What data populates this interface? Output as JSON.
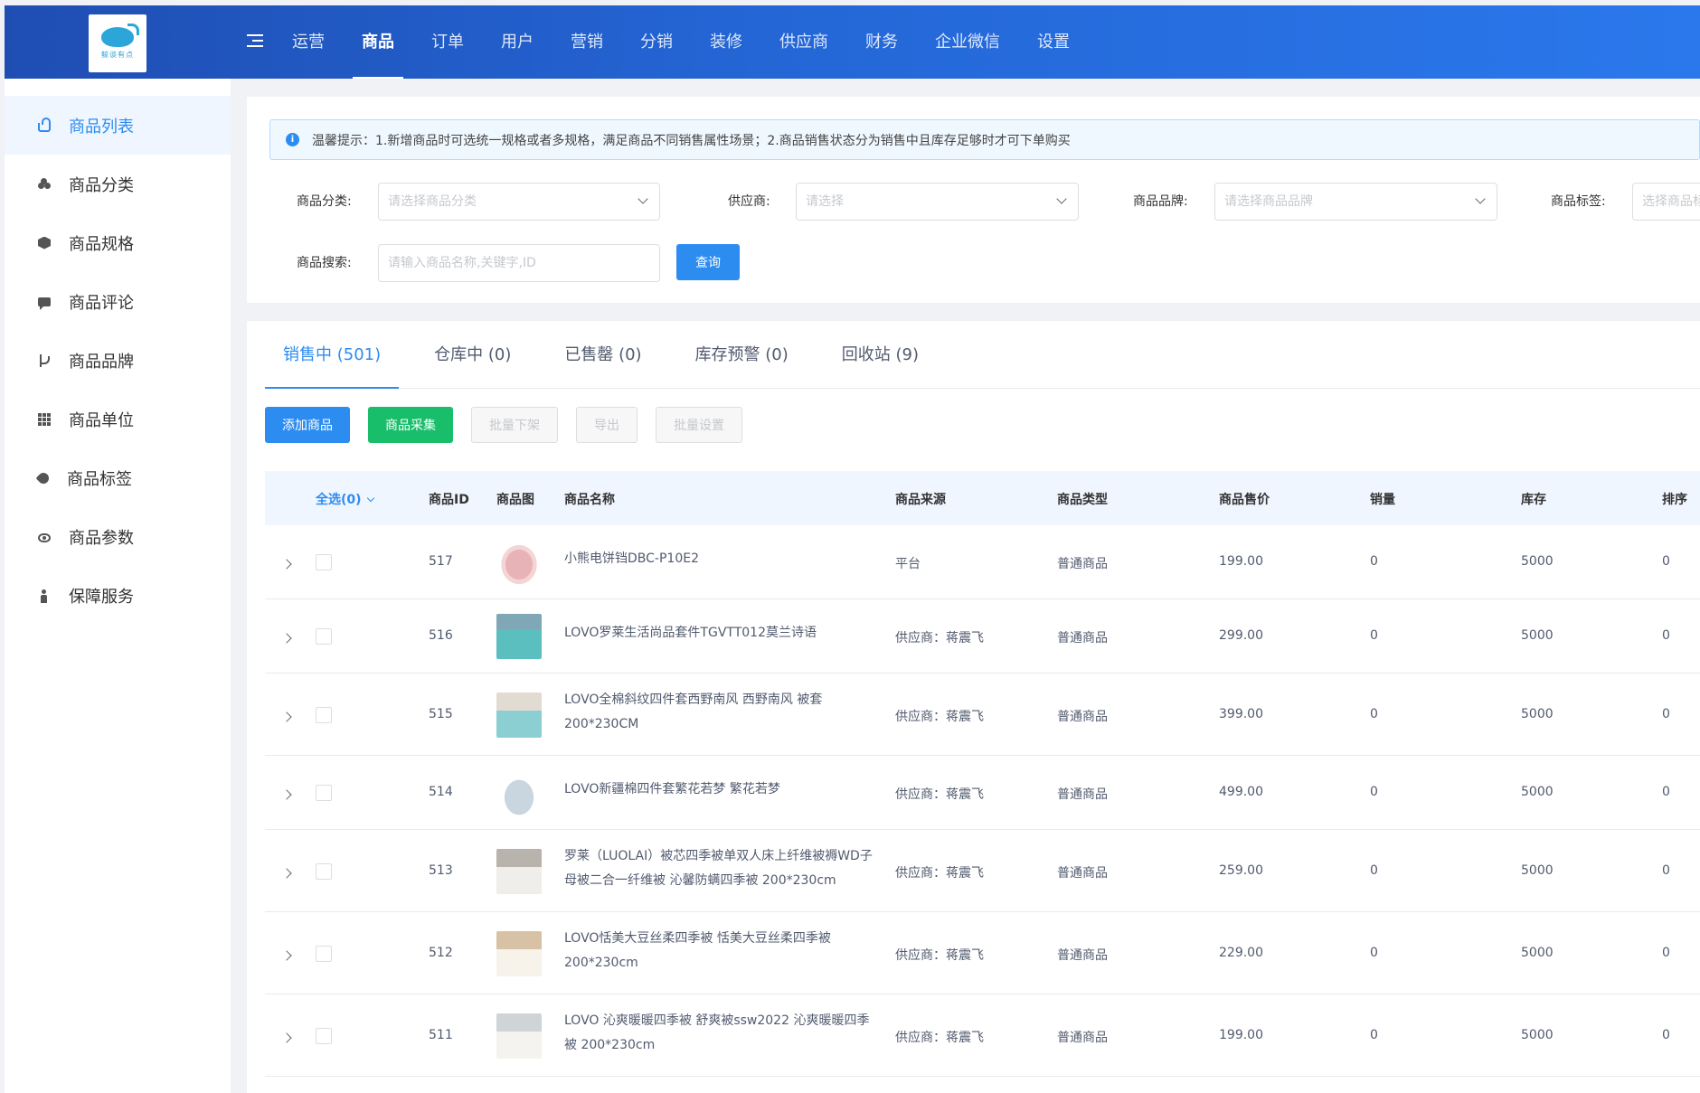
{
  "header": {
    "logo_text": "鲸谈有点",
    "nav": [
      {
        "label": "运营",
        "active": false
      },
      {
        "label": "商品",
        "active": true
      },
      {
        "label": "订单",
        "active": false
      },
      {
        "label": "用户",
        "active": false
      },
      {
        "label": "营销",
        "active": false
      },
      {
        "label": "分销",
        "active": false
      },
      {
        "label": "装修",
        "active": false
      },
      {
        "label": "供应商",
        "active": false
      },
      {
        "label": "财务",
        "active": false
      },
      {
        "label": "企业微信",
        "active": false
      },
      {
        "label": "设置",
        "active": false
      }
    ]
  },
  "sidebar": {
    "items": [
      {
        "label": "商品列表",
        "icon": "basket-icon",
        "active": true
      },
      {
        "label": "商品分类",
        "icon": "category-icon",
        "active": false
      },
      {
        "label": "商品规格",
        "icon": "cube-icon",
        "active": false
      },
      {
        "label": "商品评论",
        "icon": "comment-icon",
        "active": false
      },
      {
        "label": "商品品牌",
        "icon": "brand-icon",
        "active": false
      },
      {
        "label": "商品单位",
        "icon": "grid-icon",
        "active": false
      },
      {
        "label": "商品标签",
        "icon": "tag-icon",
        "active": false
      },
      {
        "label": "商品参数",
        "icon": "eye-icon",
        "active": false
      },
      {
        "label": "保障服务",
        "icon": "person-icon",
        "active": false
      }
    ]
  },
  "notice": {
    "text": "温馨提示：1.新增商品时可选统一规格或者多规格，满足商品不同销售属性场景；2.商品销售状态分为销售中且库存足够时才可下单购买"
  },
  "filters": {
    "category_label": "商品分类:",
    "category_placeholder": "请选择商品分类",
    "supplier_label": "供应商:",
    "supplier_placeholder": "请选择",
    "brand_label": "商品品牌:",
    "brand_placeholder": "请选择商品品牌",
    "tag_label": "商品标签:",
    "tag_placeholder": "选择商品标签",
    "search_label": "商品搜索:",
    "search_placeholder": "请输入商品名称,关键字,ID",
    "query_label": "查询"
  },
  "tabs": [
    {
      "label": "销售中 (501)",
      "active": true
    },
    {
      "label": "仓库中 (0)",
      "active": false
    },
    {
      "label": "已售罄 (0)",
      "active": false
    },
    {
      "label": "库存预警 (0)",
      "active": false
    },
    {
      "label": "回收站 (9)",
      "active": false
    }
  ],
  "actions": {
    "add": "添加商品",
    "collect": "商品采集",
    "batch_off": "批量下架",
    "export": "导出",
    "batch_set": "批量设置"
  },
  "table": {
    "headers": {
      "select_all": "全选(0)",
      "id": "商品ID",
      "image": "商品图",
      "name": "商品名称",
      "source": "商品来源",
      "type": "商品类型",
      "price": "商品售价",
      "sales": "销量",
      "stock": "库存",
      "sort": "排序"
    },
    "rows": [
      {
        "id": "517",
        "name": "小熊电饼铛DBC-P10E2",
        "source": "平台",
        "type": "普通商品",
        "price": "199.00",
        "sales": "0",
        "stock": "5000",
        "sort": "0",
        "thumb": "pink"
      },
      {
        "id": "516",
        "name": "LOVO罗莱生活尚品套件TGVTT012莫兰诗语",
        "source": "供应商：蒋震飞",
        "type": "普通商品",
        "price": "299.00",
        "sales": "0",
        "stock": "5000",
        "sort": "0",
        "thumb": "teal"
      },
      {
        "id": "515",
        "name": "LOVO全棉斜纹四件套西野南风 西野南风 被套200*230CM",
        "source": "供应商：蒋震飞",
        "type": "普通商品",
        "price": "399.00",
        "sales": "0",
        "stock": "5000",
        "sort": "0",
        "thumb": "aqua"
      },
      {
        "id": "514",
        "name": "LOVO新疆棉四件套繁花若梦 繁花若梦",
        "source": "供应商：蒋震飞",
        "type": "普通商品",
        "price": "499.00",
        "sales": "0",
        "stock": "5000",
        "sort": "0",
        "thumb": "floral"
      },
      {
        "id": "513",
        "name": "罗莱（LUOLAI）被芯四季被单双人床上纤维被褥WD子母被二合一纤维被 沁馨防螨四季被 200*230cm",
        "source": "供应商：蒋震飞",
        "type": "普通商品",
        "price": "259.00",
        "sales": "0",
        "stock": "5000",
        "sort": "0",
        "thumb": "white"
      },
      {
        "id": "512",
        "name": "LOVO恬美大豆丝柔四季被 恬美大豆丝柔四季被 200*230cm",
        "source": "供应商：蒋震飞",
        "type": "普通商品",
        "price": "229.00",
        "sales": "0",
        "stock": "5000",
        "sort": "0",
        "thumb": "warm"
      },
      {
        "id": "511",
        "name": "LOVO 沁爽暖暖四季被 舒爽被ssw2022 沁爽暖暖四季被 200*230cm",
        "source": "供应商：蒋震飞",
        "type": "普通商品",
        "price": "199.00",
        "sales": "0",
        "stock": "5000",
        "sort": "0",
        "thumb": "light"
      }
    ]
  },
  "colors": {
    "primary": "#2d8cf0",
    "success": "#19be6b",
    "header_from": "#1f4eb3",
    "header_to": "#2a78ec"
  }
}
